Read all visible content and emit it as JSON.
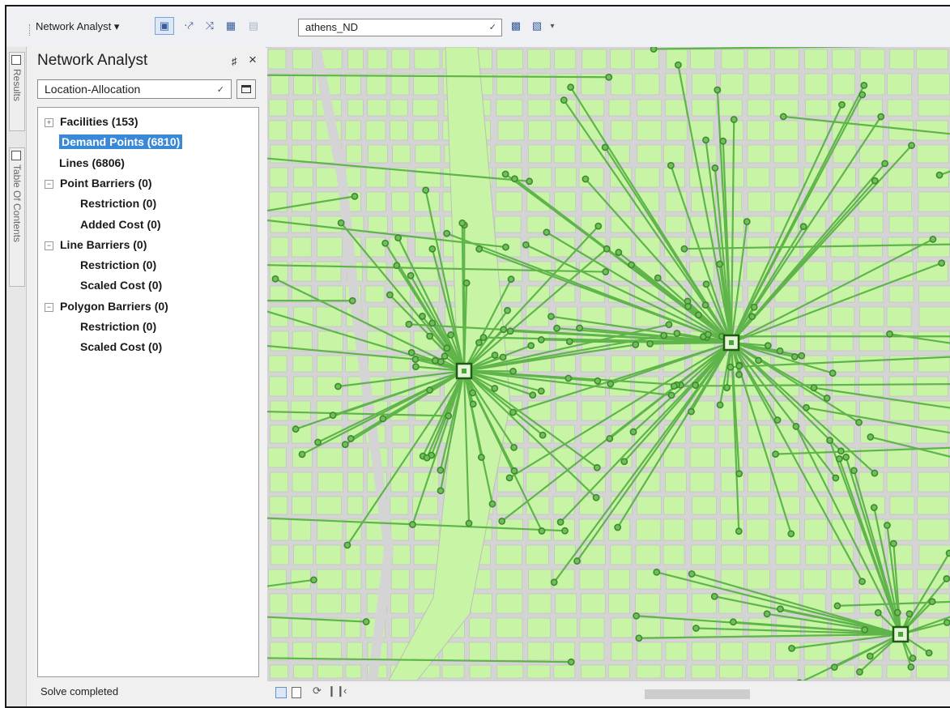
{
  "toolbar": {
    "menu_label": "Network Analyst ▾",
    "network_dataset": "athens_ND",
    "icons": [
      "network-analyst-window-icon",
      "create-features-icon",
      "select-move-icon",
      "solve-icon",
      "directions-icon",
      "build-icon",
      "time-window-icon"
    ]
  },
  "side_tabs": [
    {
      "label": "Results"
    },
    {
      "label": "Table Of Contents"
    }
  ],
  "panel": {
    "title": "Network Analyst",
    "analysis_layer": "Location-Allocation",
    "tree": [
      {
        "label": "Facilities (153)",
        "expander": "+",
        "level": 0
      },
      {
        "label": "Demand Points (6810)",
        "expander": "",
        "level": 0,
        "selected": true
      },
      {
        "label": "Lines (6806)",
        "expander": "",
        "level": 0
      },
      {
        "label": "Point Barriers (0)",
        "expander": "−",
        "level": 0
      },
      {
        "label": "Restriction (0)",
        "expander": "",
        "level": 1
      },
      {
        "label": "Added Cost (0)",
        "expander": "",
        "level": 1
      },
      {
        "label": "Line Barriers (0)",
        "expander": "−",
        "level": 0
      },
      {
        "label": "Restriction (0)",
        "expander": "",
        "level": 1
      },
      {
        "label": "Scaled Cost (0)",
        "expander": "",
        "level": 1
      },
      {
        "label": "Polygon Barriers (0)",
        "expander": "−",
        "level": 0
      },
      {
        "label": "Restriction (0)",
        "expander": "",
        "level": 1
      },
      {
        "label": "Scaled Cost (0)",
        "expander": "",
        "level": 1
      }
    ],
    "status": "Solve completed"
  },
  "map": {
    "colors": {
      "block": "#c8f5a5",
      "street": "#d4d4d4",
      "line": "#5fb44a",
      "point": "#3f8a2c",
      "facility": "#1d5c14"
    }
  }
}
